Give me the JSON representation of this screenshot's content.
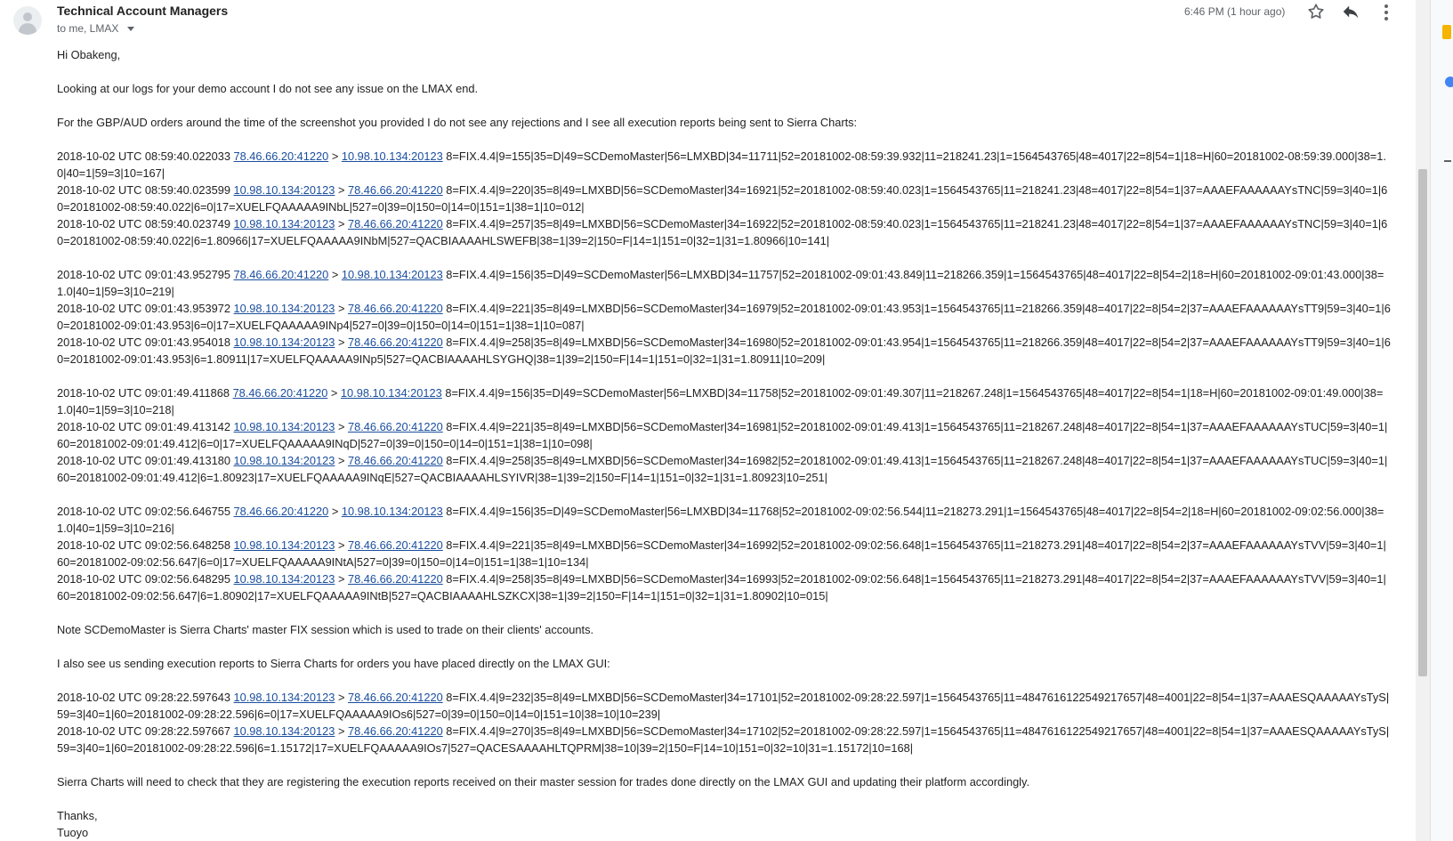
{
  "header": {
    "sender": "Technical Account Managers",
    "recipients": "to me, LMAX",
    "time": "6:46 PM (1 hour ago)"
  },
  "icons": {
    "avatar": "person-avatar-icon",
    "star": "star-icon",
    "reply": "reply-icon",
    "more": "more-vert-icon",
    "dropdown": "caret-down-icon"
  },
  "colors": {
    "link": "#1a4e9e",
    "text": "#222222",
    "muted": "#5f6368"
  },
  "body": {
    "greeting": "Hi Obakeng,",
    "p1": "Looking at our logs for your demo account I do not see any issue on the LMAX end.",
    "p2": "For the GBP/AUD orders around the time of the screenshot you provided I do not see any rejections and I see all execution reports being sent to Sierra Charts:",
    "log_groups": [
      [
        {
          "ts": "2018-10-02 UTC 08:59:40.022033",
          "from": "78.46.66.20:41220",
          "to": "10.98.10.134:20123",
          "msg": "8=FIX.4.4|9=155|35=D|49=SCDemoMaster|56=LMXBD|34=11711|52=20181002-08:59:39.932|11=218241.23|1=1564543765|48=4017|22=8|54=1|18=H|60=20181002-08:59:39.000|38=1.0|40=1|59=3|10=167|"
        },
        {
          "ts": "2018-10-02 UTC 08:59:40.023599",
          "from": "10.98.10.134:20123",
          "to": "78.46.66.20:41220",
          "msg": "8=FIX.4.4|9=220|35=8|49=LMXBD|56=SCDemoMaster|34=16921|52=20181002-08:59:40.023|1=1564543765|11=218241.23|48=4017|22=8|54=1|37=AAAEFAAAAAAYsTNC|59=3|40=1|60=20181002-08:59:40.022|6=0|17=XUELFQAAAAA9INbL|527=0|39=0|150=0|14=0|151=1|38=1|10=012|"
        },
        {
          "ts": "2018-10-02 UTC 08:59:40.023749",
          "from": "10.98.10.134:20123",
          "to": "78.46.66.20:41220",
          "msg": "8=FIX.4.4|9=257|35=8|49=LMXBD|56=SCDemoMaster|34=16922|52=20181002-08:59:40.023|1=1564543765|11=218241.23|48=4017|22=8|54=1|37=AAAEFAAAAAAYsTNC|59=3|40=1|60=20181002-08:59:40.022|6=1.80966|17=XUELFQAAAAA9INbM|527=QACBIAAAAHLSWEFB|38=1|39=2|150=F|14=1|151=0|32=1|31=1.80966|10=141|"
        }
      ],
      [
        {
          "ts": "2018-10-02 UTC 09:01:43.952795",
          "from": "78.46.66.20:41220",
          "to": "10.98.10.134:20123",
          "msg": "8=FIX.4.4|9=156|35=D|49=SCDemoMaster|56=LMXBD|34=11757|52=20181002-09:01:43.849|11=218266.359|1=1564543765|48=4017|22=8|54=2|18=H|60=20181002-09:01:43.000|38=1.0|40=1|59=3|10=219|"
        },
        {
          "ts": "2018-10-02 UTC 09:01:43.953972",
          "from": "10.98.10.134:20123",
          "to": "78.46.66.20:41220",
          "msg": "8=FIX.4.4|9=221|35=8|49=LMXBD|56=SCDemoMaster|34=16979|52=20181002-09:01:43.953|1=1564543765|11=218266.359|48=4017|22=8|54=2|37=AAAEFAAAAAAYsTT9|59=3|40=1|60=20181002-09:01:43.953|6=0|17=XUELFQAAAAA9INp4|527=0|39=0|150=0|14=0|151=1|38=1|10=087|"
        },
        {
          "ts": "2018-10-02 UTC 09:01:43.954018",
          "from": "10.98.10.134:20123",
          "to": "78.46.66.20:41220",
          "msg": "8=FIX.4.4|9=258|35=8|49=LMXBD|56=SCDemoMaster|34=16980|52=20181002-09:01:43.954|1=1564543765|11=218266.359|48=4017|22=8|54=2|37=AAAEFAAAAAAYsTT9|59=3|40=1|60=20181002-09:01:43.953|6=1.80911|17=XUELFQAAAAA9INp5|527=QACBIAAAAHLSYGHQ|38=1|39=2|150=F|14=1|151=0|32=1|31=1.80911|10=209|"
        }
      ],
      [
        {
          "ts": "2018-10-02 UTC 09:01:49.411868",
          "from": "78.46.66.20:41220",
          "to": "10.98.10.134:20123",
          "msg": "8=FIX.4.4|9=156|35=D|49=SCDemoMaster|56=LMXBD|34=11758|52=20181002-09:01:49.307|11=218267.248|1=1564543765|48=4017|22=8|54=1|18=H|60=20181002-09:01:49.000|38=1.0|40=1|59=3|10=218|"
        },
        {
          "ts": "2018-10-02 UTC 09:01:49.413142",
          "from": "10.98.10.134:20123",
          "to": "78.46.66.20:41220",
          "msg": "8=FIX.4.4|9=221|35=8|49=LMXBD|56=SCDemoMaster|34=16981|52=20181002-09:01:49.413|1=1564543765|11=218267.248|48=4017|22=8|54=1|37=AAAEFAAAAAAYsTUC|59=3|40=1|60=20181002-09:01:49.412|6=0|17=XUELFQAAAAA9INqD|527=0|39=0|150=0|14=0|151=1|38=1|10=098|"
        },
        {
          "ts": "2018-10-02 UTC 09:01:49.413180",
          "from": "10.98.10.134:20123",
          "to": "78.46.66.20:41220",
          "msg": "8=FIX.4.4|9=258|35=8|49=LMXBD|56=SCDemoMaster|34=16982|52=20181002-09:01:49.413|1=1564543765|11=218267.248|48=4017|22=8|54=1|37=AAAEFAAAAAAYsTUC|59=3|40=1|60=20181002-09:01:49.412|6=1.80923|17=XUELFQAAAAA9INqE|527=QACBIAAAAHLSYIVR|38=1|39=2|150=F|14=1|151=0|32=1|31=1.80923|10=251|"
        }
      ],
      [
        {
          "ts": "2018-10-02 UTC 09:02:56.646755",
          "from": "78.46.66.20:41220",
          "to": "10.98.10.134:20123",
          "msg": "8=FIX.4.4|9=156|35=D|49=SCDemoMaster|56=LMXBD|34=11768|52=20181002-09:02:56.544|11=218273.291|1=1564543765|48=4017|22=8|54=2|18=H|60=20181002-09:02:56.000|38=1.0|40=1|59=3|10=216|"
        },
        {
          "ts": "2018-10-02 UTC 09:02:56.648258",
          "from": "10.98.10.134:20123",
          "to": "78.46.66.20:41220",
          "msg": "8=FIX.4.4|9=221|35=8|49=LMXBD|56=SCDemoMaster|34=16992|52=20181002-09:02:56.648|1=1564543765|11=218273.291|48=4017|22=8|54=2|37=AAAEFAAAAAAYsTVV|59=3|40=1|60=20181002-09:02:56.647|6=0|17=XUELFQAAAAA9INtA|527=0|39=0|150=0|14=0|151=1|38=1|10=134|"
        },
        {
          "ts": "2018-10-02 UTC 09:02:56.648295",
          "from": "10.98.10.134:20123",
          "to": "78.46.66.20:41220",
          "msg": "8=FIX.4.4|9=258|35=8|49=LMXBD|56=SCDemoMaster|34=16993|52=20181002-09:02:56.648|1=1564543765|11=218273.291|48=4017|22=8|54=2|37=AAAEFAAAAAAYsTVV|59=3|40=1|60=20181002-09:02:56.647|6=1.80902|17=XUELFQAAAAA9INtB|527=QACBIAAAAHLSZKCX|38=1|39=2|150=F|14=1|151=0|32=1|31=1.80902|10=015|"
        }
      ]
    ],
    "note": "Note SCDemoMaster is Sierra Charts' master FIX session which is used to trade on their clients' accounts.",
    "p3": "I also see us sending execution reports to Sierra Charts for orders you have placed directly on the LMAX GUI:",
    "gui_logs": [
      {
        "ts": "2018-10-02 UTC 09:28:22.597643",
        "from": "10.98.10.134:20123",
        "to": "78.46.66.20:41220",
        "msg": "8=FIX.4.4|9=232|35=8|49=LMXBD|56=SCDemoMaster|34=17101|52=20181002-09:28:22.597|1=1564543765|11=4847616122549217657|48=4001|22=8|54=1|37=AAAESQAAAAAYsTyS|59=3|40=1|60=20181002-09:28:22.596|6=0|17=XUELFQAAAAA9IOs6|527=0|39=0|150=0|14=0|151=10|38=10|10=239|"
      },
      {
        "ts": "2018-10-02 UTC 09:28:22.597667",
        "from": "10.98.10.134:20123",
        "to": "78.46.66.20:41220",
        "msg": "8=FIX.4.4|9=270|35=8|49=LMXBD|56=SCDemoMaster|34=17102|52=20181002-09:28:22.597|1=1564543765|11=4847616122549217657|48=4001|22=8|54=1|37=AAAESQAAAAAYsTyS|59=3|40=1|60=20181002-09:28:22.596|6=1.15172|17=XUELFQAAAAA9IOs7|527=QACESAAAAHLTQPRM|38=10|39=2|150=F|14=10|151=0|32=10|31=1.15172|10=168|"
      }
    ],
    "p4": "Sierra Charts will need to check that they are registering the execution reports received on their master session for trades done directly on the LMAX GUI and updating their platform accordingly.",
    "signoff": "Thanks,",
    "signature": "Tuoyo"
  }
}
